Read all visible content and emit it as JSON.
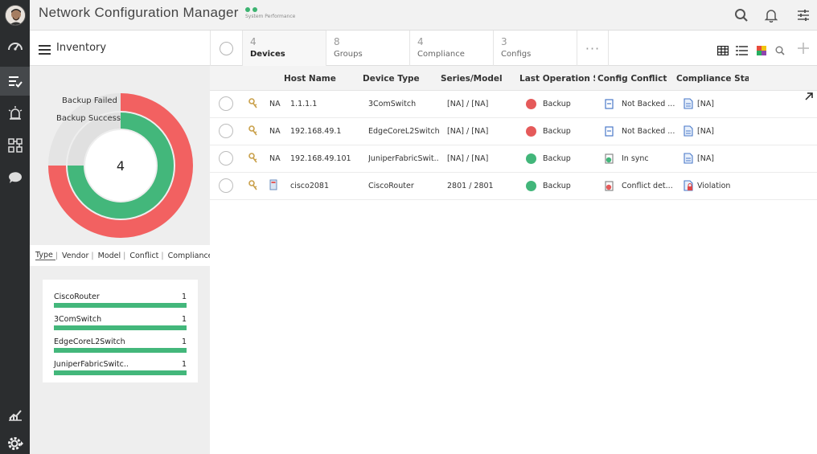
{
  "header": {
    "app_title": "Network Configuration Manager",
    "system_status_label": "System Performance",
    "status_color": "#3cb371"
  },
  "icons": {
    "search": "search-icon",
    "notifications": "bell-icon",
    "settings": "sliders-icon",
    "menu": "hamburger-icon"
  },
  "subbar": {
    "title": "Inventory",
    "tabs": [
      {
        "count": "4",
        "label": "Devices",
        "active": true
      },
      {
        "count": "8",
        "label": "Groups",
        "active": false
      },
      {
        "count": "4",
        "label": "Compliance",
        "active": false
      },
      {
        "count": "3",
        "label": "Configs",
        "active": false
      }
    ],
    "more": "···"
  },
  "widget": {
    "donut": {
      "center_value": "4",
      "outer_label": "Backup Failed",
      "inner_label": "Backup Success",
      "outer_color": "#f26161",
      "inner_color": "#43b77b",
      "outer_fraction": 0.75,
      "inner_fraction": 0.75
    },
    "filters": [
      "Type",
      "Vendor",
      "Model",
      "Conflict",
      "Compliance"
    ],
    "bars": [
      {
        "name": "CiscoRouter",
        "value": "1"
      },
      {
        "name": "3ComSwitch",
        "value": "1"
      },
      {
        "name": "EdgeCoreL2Switch",
        "value": "1"
      },
      {
        "name": "JuniperFabricSwitc..",
        "value": "1"
      }
    ],
    "bar_color": "#43b77b"
  },
  "table": {
    "columns": [
      "Host Name",
      "Device Type",
      "Series/Model",
      "Last Operation St",
      "Config Conflict",
      "Compliance Statu"
    ],
    "rows": [
      {
        "prefix": "NA",
        "host": "1.1.1.1",
        "type": "3ComSwitch",
        "model": "[NA] / [NA]",
        "op_status": "error",
        "op": "Backup",
        "conflict_icon": "not-backed-icon",
        "conflict": "Not Backed ...",
        "compliance_icon": "doc-icon",
        "compliance": "[NA]"
      },
      {
        "prefix": "NA",
        "host": "192.168.49.1",
        "type": "EdgeCoreL2Switch",
        "model": "[NA] / [NA]",
        "op_status": "error",
        "op": "Backup",
        "conflict_icon": "not-backed-icon",
        "conflict": "Not Backed ...",
        "compliance_icon": "doc-icon",
        "compliance": "[NA]"
      },
      {
        "prefix": "NA",
        "host": "192.168.49.101",
        "type": "JuniperFabricSwit...",
        "model": "[NA] / [NA]",
        "op_status": "ok",
        "op": "Backup",
        "conflict_icon": "in-sync-icon",
        "conflict": "In sync",
        "compliance_icon": "doc-icon",
        "compliance": "[NA]"
      },
      {
        "prefix": "",
        "host": "cisco2081",
        "type": "CiscoRouter",
        "model": "2801 / 2801",
        "op_status": "ok",
        "op": "Backup",
        "conflict_icon": "conflict-icon",
        "conflict": "Conflict det...",
        "compliance_icon": "violation-lock-icon",
        "compliance": "Violation"
      }
    ]
  }
}
